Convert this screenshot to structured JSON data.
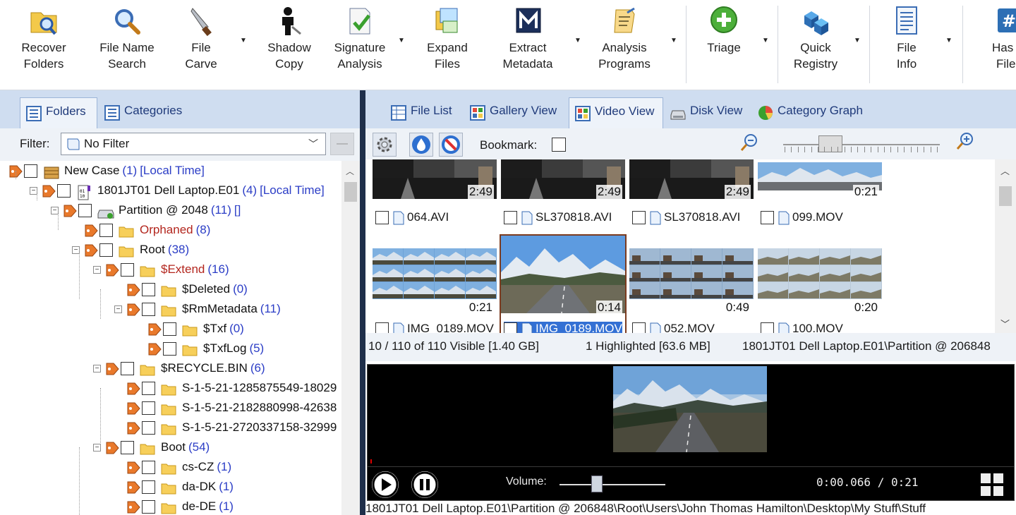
{
  "ribbon": {
    "buttons": [
      {
        "line1": "Recover",
        "line2": "Folders",
        "icon": "recover-folders-icon"
      },
      {
        "line1": "File Name",
        "line2": "Search",
        "icon": "magnifier-icon"
      },
      {
        "line1": "File",
        "line2": "Carve",
        "icon": "knife-icon"
      },
      {
        "line1": "Shadow",
        "line2": "Copy",
        "icon": "shadow-person-icon"
      },
      {
        "line1": "Signature",
        "line2": "Analysis",
        "icon": "signature-check-icon"
      },
      {
        "line1": "Expand",
        "line2": "Files",
        "icon": "expand-files-icon"
      },
      {
        "line1": "Extract",
        "line2": "Metadata",
        "icon": "metadata-m-icon"
      },
      {
        "line1": "Analysis",
        "line2": "Programs",
        "icon": "analysis-programs-icon"
      },
      {
        "line1": "Triage",
        "line2": "",
        "icon": "triage-plus-icon"
      },
      {
        "line1": "Quick",
        "line2": "Registry",
        "icon": "registry-cubes-icon"
      },
      {
        "line1": "File",
        "line2": "Info",
        "icon": "file-info-icon"
      },
      {
        "line1": "Has",
        "line2": "File",
        "icon": "hash-icon"
      }
    ]
  },
  "left": {
    "tabs": [
      {
        "label": "Folders",
        "active": true
      },
      {
        "label": "Categories",
        "active": false
      }
    ],
    "filter_label": "Filter:",
    "filter_value": "No Filter",
    "tree": [
      {
        "name": "New Case",
        "count": "(1)",
        "extra": "[Local Time]",
        "level": 0
      },
      {
        "name": "1801JT01 Dell Laptop.E01",
        "count": "(4)",
        "extra": "[Local Time]",
        "level": 1
      },
      {
        "name": "Partition @ 2048",
        "count": "(11)",
        "extra": "[]",
        "level": 2
      },
      {
        "name": "Orphaned",
        "count": "(8)",
        "extra": "",
        "level": 3
      },
      {
        "name": "Root",
        "count": "(38)",
        "extra": "",
        "level": 3
      },
      {
        "name": "$Extend",
        "count": "(16)",
        "extra": "",
        "level": 4
      },
      {
        "name": "$Deleted",
        "count": "(0)",
        "extra": "",
        "level": 5
      },
      {
        "name": "$RmMetadata",
        "count": "(11)",
        "extra": "",
        "level": 5
      },
      {
        "name": "$Txf",
        "count": "(0)",
        "extra": "",
        "level": 6
      },
      {
        "name": "$TxfLog",
        "count": "(5)",
        "extra": "",
        "level": 6
      },
      {
        "name": "$RECYCLE.BIN",
        "count": "(6)",
        "extra": "",
        "level": 4
      },
      {
        "name": "S-1-5-21-1285875549-18029",
        "count": "",
        "extra": "",
        "level": 5
      },
      {
        "name": "S-1-5-21-2182880998-42638",
        "count": "",
        "extra": "",
        "level": 5
      },
      {
        "name": "S-1-5-21-2720337158-32999",
        "count": "",
        "extra": "",
        "level": 5
      },
      {
        "name": "Boot",
        "count": "(54)",
        "extra": "",
        "level": 4
      },
      {
        "name": "cs-CZ",
        "count": "(1)",
        "extra": "",
        "level": 5
      },
      {
        "name": "da-DK",
        "count": "(1)",
        "extra": "",
        "level": 5
      },
      {
        "name": "de-DE",
        "count": "(1)",
        "extra": "",
        "level": 5
      }
    ]
  },
  "right": {
    "tabs": [
      {
        "label": "File List",
        "active": false
      },
      {
        "label": "Gallery View",
        "active": false
      },
      {
        "label": "Video View",
        "active": true
      },
      {
        "label": "Disk View",
        "active": false
      },
      {
        "label": "Category Graph",
        "active": false
      }
    ],
    "bookmark_label": "Bookmark:",
    "videos": [
      {
        "name": "064.AVI",
        "duration": "2:49",
        "selected": false
      },
      {
        "name": "SL370818.AVI",
        "duration": "2:49",
        "selected": false
      },
      {
        "name": "SL370818.AVI",
        "duration": "2:49",
        "selected": false
      },
      {
        "name": "099.MOV",
        "duration": "0:21",
        "selected": false
      },
      {
        "name": "IMG_0189.MOV",
        "duration": "0:21",
        "selected": false
      },
      {
        "name": "IMG_0189.MOV",
        "duration": "0:14",
        "selected": true
      },
      {
        "name": "052.MOV",
        "duration": "0:49",
        "selected": false
      },
      {
        "name": "100.MOV",
        "duration": "0:20",
        "selected": false
      }
    ],
    "status": {
      "visible": "10  /  110 of 110 Visible [1.40 GB]",
      "highlighted": "1 Highlighted [63.6 MB]",
      "location": "1801JT01 Dell Laptop.E01\\Partition @ 206848"
    },
    "player": {
      "volume_label": "Volume:",
      "volume_level": 0.35,
      "timecode": "0:00.066 / 0:21"
    },
    "path": "1801JT01 Dell Laptop.E01\\Partition @ 206848\\Root\\Users\\John Thomas Hamilton\\Desktop\\My Stuff\\Stuff"
  },
  "colors": {
    "tab_bar": "#cfddf0",
    "link_blue": "#2b3dc6",
    "red_text": "#b3261e",
    "selection_blue": "#3370d4"
  }
}
